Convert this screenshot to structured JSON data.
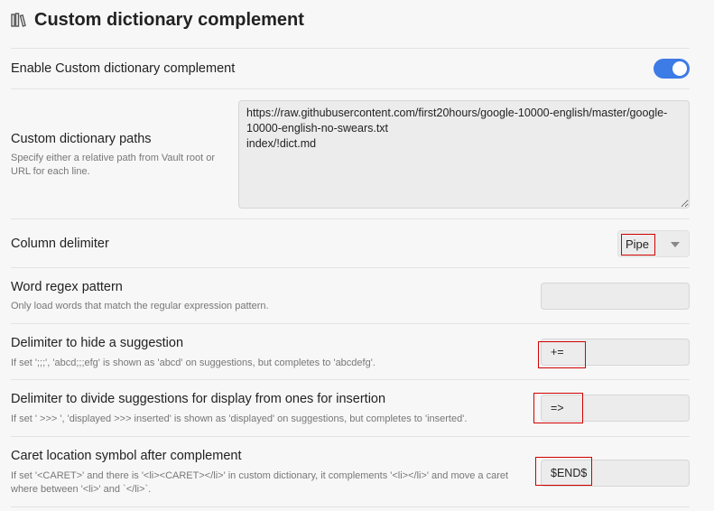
{
  "header": {
    "title": "Custom dictionary complement",
    "icon": "books-icon"
  },
  "settings": {
    "enable": {
      "name": "Enable Custom dictionary complement",
      "enabled": true,
      "accent": "#3d7be6"
    },
    "paths": {
      "name": "Custom dictionary paths",
      "desc": "Specify either a relative path from Vault root or URL for each line.",
      "value": "https://raw.githubusercontent.com/first20hours/google-10000-english/master/google-10000-english-no-swears.txt\nindex/!dict.md"
    },
    "column_delimiter": {
      "name": "Column delimiter",
      "selected": "Pipe"
    },
    "word_regex": {
      "name": "Word regex pattern",
      "desc": "Only load words that match the regular expression pattern.",
      "value": ""
    },
    "hide_delimiter": {
      "name": "Delimiter to hide a suggestion",
      "desc": "If set ';;;', 'abcd;;;efg' is shown as 'abcd' on suggestions, but completes to 'abcdefg'.",
      "value": "+="
    },
    "divide_delimiter": {
      "name": "Delimiter to divide suggestions for display from ones for insertion",
      "desc": "If set ' >>> ', 'displayed >>> inserted' is shown as 'displayed' on suggestions, but completes to 'inserted'.",
      "value": "=>"
    },
    "caret_symbol": {
      "name": "Caret location symbol after complement",
      "desc": "If set '<CARET>' and there is '<li><CARET></li>' in custom dictionary, it complements '<li></li>' and move a caret where between '<li>' and `</li>`.",
      "value": "$END$"
    }
  }
}
